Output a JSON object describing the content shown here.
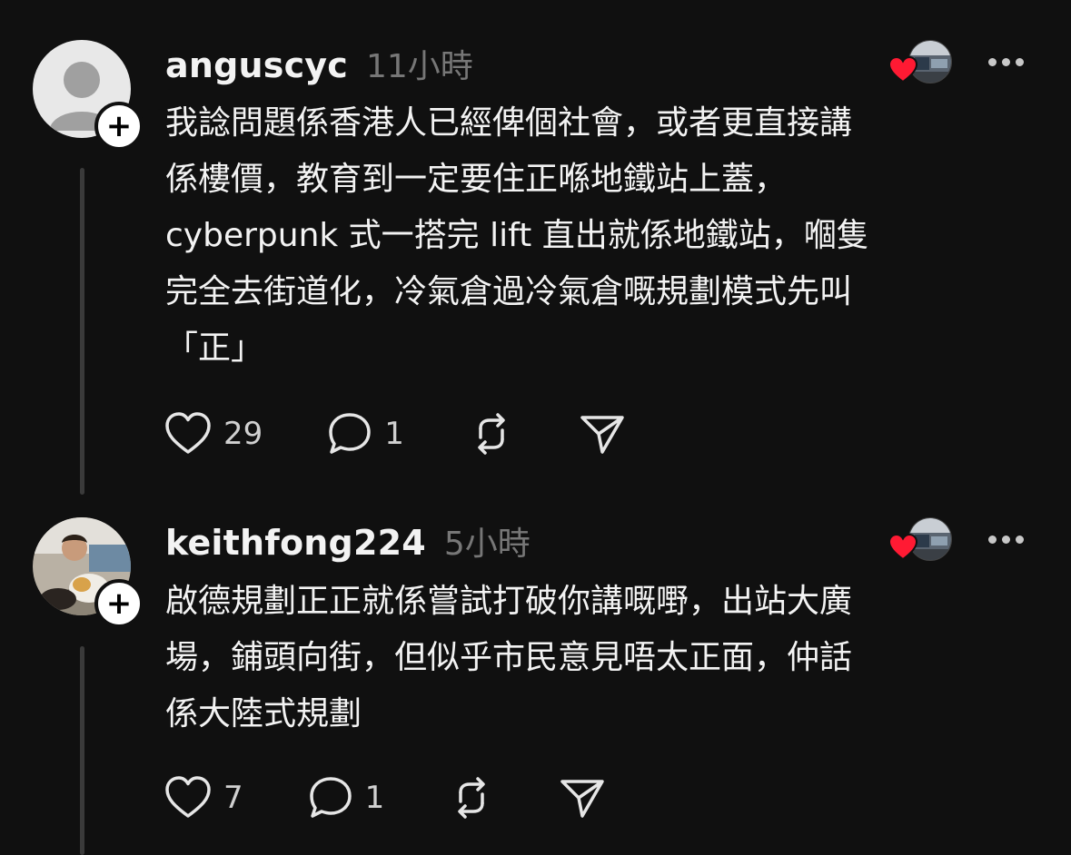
{
  "posts": [
    {
      "username": "anguscyc",
      "timestamp": "11小時",
      "avatar_icon": "default-profile-icon",
      "text": "我諗問題係香港人已經俾個社會，或者更直接講\n係樓價，教育到一定要住正喺地鐵站上蓋，\ncyberpunk 式一搭完 lift 直出就係地鐵站，嗰隻\n完全去街道化，冷氣倉過冷氣倉嘅規劃模式先叫\n「正」",
      "likes": "29",
      "replies": "1"
    },
    {
      "username": "keithfong224",
      "timestamp": "5小時",
      "avatar_icon": "photo-avatar",
      "text": "啟德規劃正正就係嘗試打破你講嘅嘢，出站大廣\n場，鋪頭向街，但似乎市民意見唔太正面，仲話\n係大陸式規劃",
      "likes": "7",
      "replies": "1"
    }
  ],
  "colors": {
    "background": "#101010",
    "text": "#f3f3f3",
    "muted": "#777777",
    "heart": "#ff1a33",
    "thread_line": "#3a3a3a"
  }
}
